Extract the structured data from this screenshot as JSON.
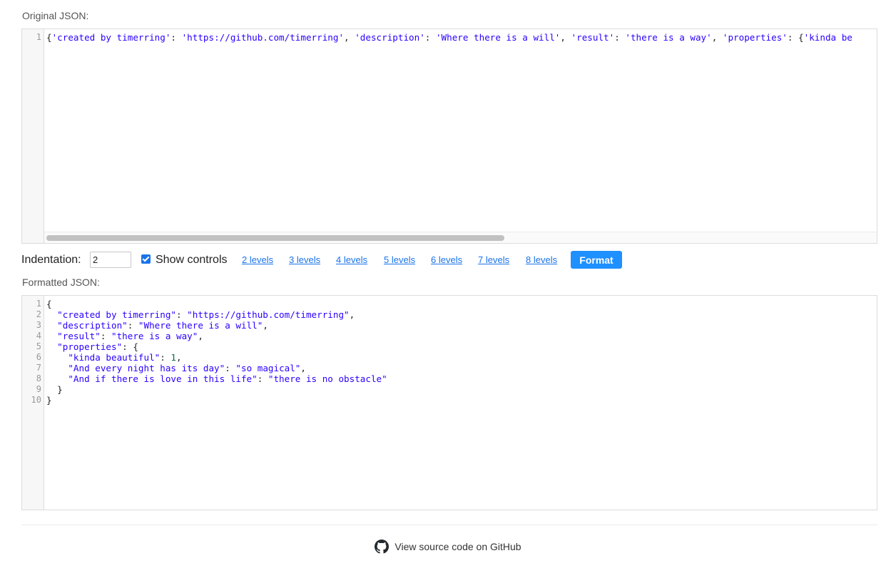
{
  "original": {
    "label": "Original JSON:",
    "line_numbers": [
      "1"
    ],
    "tokens": [
      {
        "t": "{",
        "k": "punc"
      },
      {
        "t": "'created by timerring'",
        "k": "str"
      },
      {
        "t": ": ",
        "k": "punc"
      },
      {
        "t": "'https://github.com/timerring'",
        "k": "str"
      },
      {
        "t": ", ",
        "k": "punc"
      },
      {
        "t": "'description'",
        "k": "str"
      },
      {
        "t": ": ",
        "k": "punc"
      },
      {
        "t": "'Where there is a will'",
        "k": "str"
      },
      {
        "t": ", ",
        "k": "punc"
      },
      {
        "t": "'result'",
        "k": "str"
      },
      {
        "t": ": ",
        "k": "punc"
      },
      {
        "t": "'there is a way'",
        "k": "str"
      },
      {
        "t": ", ",
        "k": "punc"
      },
      {
        "t": "'properties'",
        "k": "str"
      },
      {
        "t": ": ",
        "k": "punc"
      },
      {
        "t": "{",
        "k": "punc"
      },
      {
        "t": "'kinda be",
        "k": "str"
      }
    ]
  },
  "controls": {
    "indentation_label": "Indentation:",
    "indentation_value": "2",
    "show_controls_label": "Show controls",
    "show_controls_checked": true,
    "levels": [
      "2 levels",
      "3 levels",
      "4 levels",
      "5 levels",
      "6 levels",
      "7 levels",
      "8 levels"
    ],
    "format_label": "Format"
  },
  "formatted": {
    "label": "Formatted JSON:",
    "line_numbers": [
      "1",
      "2",
      "3",
      "4",
      "5",
      "6",
      "7",
      "8",
      "9",
      "10"
    ],
    "lines": [
      [
        {
          "t": "{",
          "k": "punc"
        }
      ],
      [
        {
          "t": "  ",
          "k": "punc"
        },
        {
          "t": "\"created by timerring\"",
          "k": "str"
        },
        {
          "t": ": ",
          "k": "punc"
        },
        {
          "t": "\"https://github.com/timerring\"",
          "k": "str"
        },
        {
          "t": ",",
          "k": "punc"
        }
      ],
      [
        {
          "t": "  ",
          "k": "punc"
        },
        {
          "t": "\"description\"",
          "k": "str"
        },
        {
          "t": ": ",
          "k": "punc"
        },
        {
          "t": "\"Where there is a will\"",
          "k": "str"
        },
        {
          "t": ",",
          "k": "punc"
        }
      ],
      [
        {
          "t": "  ",
          "k": "punc"
        },
        {
          "t": "\"result\"",
          "k": "str"
        },
        {
          "t": ": ",
          "k": "punc"
        },
        {
          "t": "\"there is a way\"",
          "k": "str"
        },
        {
          "t": ",",
          "k": "punc"
        }
      ],
      [
        {
          "t": "  ",
          "k": "punc"
        },
        {
          "t": "\"properties\"",
          "k": "str"
        },
        {
          "t": ": {",
          "k": "punc"
        }
      ],
      [
        {
          "t": "    ",
          "k": "punc"
        },
        {
          "t": "\"kinda beautiful\"",
          "k": "str"
        },
        {
          "t": ": ",
          "k": "punc"
        },
        {
          "t": "1",
          "k": "num"
        },
        {
          "t": ",",
          "k": "punc"
        }
      ],
      [
        {
          "t": "    ",
          "k": "punc"
        },
        {
          "t": "\"And every night has its day\"",
          "k": "str"
        },
        {
          "t": ": ",
          "k": "punc"
        },
        {
          "t": "\"so magical\"",
          "k": "str"
        },
        {
          "t": ",",
          "k": "punc"
        }
      ],
      [
        {
          "t": "    ",
          "k": "punc"
        },
        {
          "t": "\"And if there is love in this life\"",
          "k": "str"
        },
        {
          "t": ": ",
          "k": "punc"
        },
        {
          "t": "\"there is no obstacle\"",
          "k": "str"
        }
      ],
      [
        {
          "t": "  }",
          "k": "punc"
        }
      ],
      [
        {
          "t": "}",
          "k": "punc"
        }
      ]
    ]
  },
  "footer": {
    "link_text": "View source code on GitHub",
    "icon": "github-icon"
  },
  "colors": {
    "accent": "#1e90ff",
    "link": "#1a73e8",
    "string": "#2a00ff",
    "number": "#116644"
  }
}
